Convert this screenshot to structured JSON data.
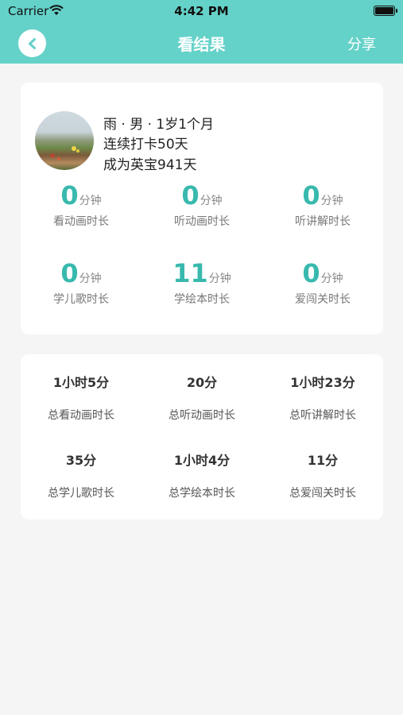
{
  "status_bar": {
    "carrier": "Carrier",
    "time": "4:42 PM"
  },
  "header": {
    "title": "看结果",
    "share_label": "分享"
  },
  "profile": {
    "line1": "雨 · 男 · 1岁1个月",
    "line2": "连续打卡50天",
    "line3": "成为英宝941天"
  },
  "stats": [
    {
      "value": "0",
      "unit": "分钟",
      "label": "看动画时长"
    },
    {
      "value": "0",
      "unit": "分钟",
      "label": "听动画时长"
    },
    {
      "value": "0",
      "unit": "分钟",
      "label": "听讲解时长"
    },
    {
      "value": "0",
      "unit": "分钟",
      "label": "学儿歌时长"
    },
    {
      "value": "11",
      "unit": "分钟",
      "label": "学绘本时长"
    },
    {
      "value": "0",
      "unit": "分钟",
      "label": "爱闯关时长"
    }
  ],
  "totals": [
    {
      "value": "1小时5分",
      "label": "总看动画时长"
    },
    {
      "value": "20分",
      "label": "总听动画时长"
    },
    {
      "value": "1小时23分",
      "label": "总听讲解时长"
    },
    {
      "value": "35分",
      "label": "总学儿歌时长"
    },
    {
      "value": "1小时4分",
      "label": "总学绘本时长"
    },
    {
      "value": "11分",
      "label": "总爱闯关时长"
    }
  ],
  "colors": {
    "header": "#65d2c9",
    "accent": "#39b9ae",
    "background": "#f5f5f5"
  }
}
